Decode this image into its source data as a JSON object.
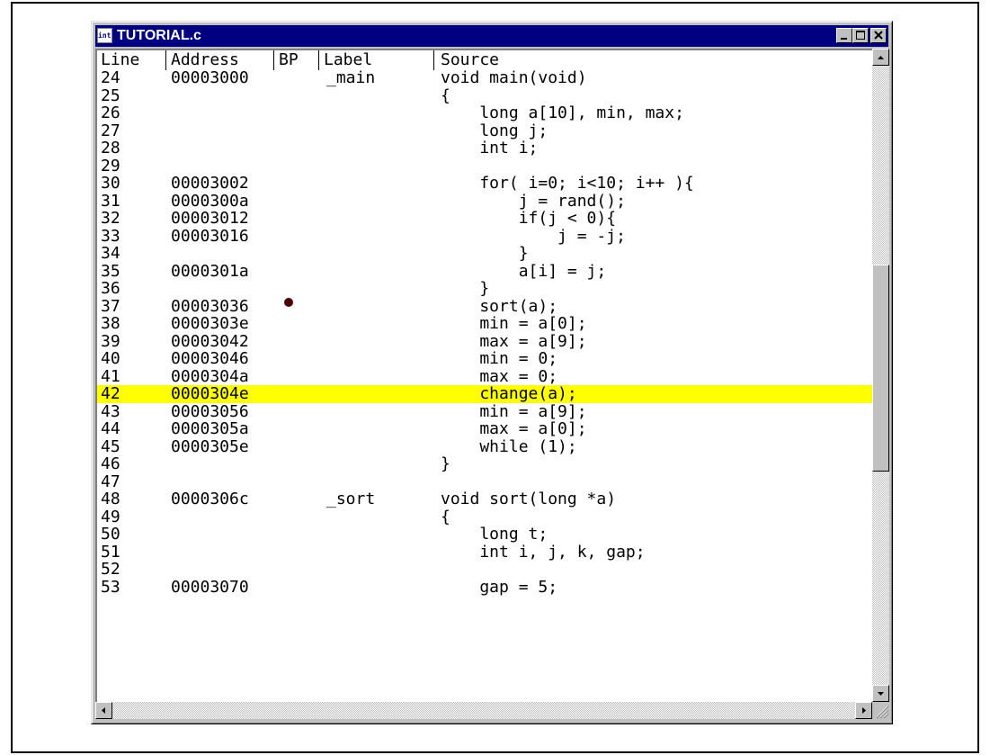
{
  "window": {
    "title": "TUTORIAL.c",
    "icon_text": "intj"
  },
  "columns": [
    "Line",
    "Address",
    "BP",
    "Label",
    "Source"
  ],
  "rows": [
    {
      "line": "24",
      "address": "00003000",
      "bp": false,
      "label": "_main",
      "source": "void main(void)"
    },
    {
      "line": "25",
      "address": "",
      "bp": false,
      "label": "",
      "source": "{"
    },
    {
      "line": "26",
      "address": "",
      "bp": false,
      "label": "",
      "source": "    long a[10], min, max;"
    },
    {
      "line": "27",
      "address": "",
      "bp": false,
      "label": "",
      "source": "    long j;"
    },
    {
      "line": "28",
      "address": "",
      "bp": false,
      "label": "",
      "source": "    int i;"
    },
    {
      "line": "29",
      "address": "",
      "bp": false,
      "label": "",
      "source": ""
    },
    {
      "line": "30",
      "address": "00003002",
      "bp": false,
      "label": "",
      "source": "    for( i=0; i<10; i++ ){"
    },
    {
      "line": "31",
      "address": "0000300a",
      "bp": false,
      "label": "",
      "source": "        j = rand();"
    },
    {
      "line": "32",
      "address": "00003012",
      "bp": false,
      "label": "",
      "source": "        if(j < 0){"
    },
    {
      "line": "33",
      "address": "00003016",
      "bp": false,
      "label": "",
      "source": "            j = -j;"
    },
    {
      "line": "34",
      "address": "",
      "bp": false,
      "label": "",
      "source": "        }"
    },
    {
      "line": "35",
      "address": "0000301a",
      "bp": false,
      "label": "",
      "source": "        a[i] = j;"
    },
    {
      "line": "36",
      "address": "",
      "bp": false,
      "label": "",
      "source": "    }"
    },
    {
      "line": "37",
      "address": "00003036",
      "bp": true,
      "label": "",
      "source": "    sort(a);"
    },
    {
      "line": "38",
      "address": "0000303e",
      "bp": false,
      "label": "",
      "source": "    min = a[0];"
    },
    {
      "line": "39",
      "address": "00003042",
      "bp": false,
      "label": "",
      "source": "    max = a[9];"
    },
    {
      "line": "40",
      "address": "00003046",
      "bp": false,
      "label": "",
      "source": "    min = 0;"
    },
    {
      "line": "41",
      "address": "0000304a",
      "bp": false,
      "label": "",
      "source": "    max = 0;"
    },
    {
      "line": "42",
      "address": "0000304e",
      "bp": false,
      "label": "",
      "source": "    change(a);",
      "current": true
    },
    {
      "line": "43",
      "address": "00003056",
      "bp": false,
      "label": "",
      "source": "    min = a[9];"
    },
    {
      "line": "44",
      "address": "0000305a",
      "bp": false,
      "label": "",
      "source": "    max = a[0];"
    },
    {
      "line": "45",
      "address": "0000305e",
      "bp": false,
      "label": "",
      "source": "    while (1);"
    },
    {
      "line": "46",
      "address": "",
      "bp": false,
      "label": "",
      "source": "}"
    },
    {
      "line": "47",
      "address": "",
      "bp": false,
      "label": "",
      "source": ""
    },
    {
      "line": "48",
      "address": "0000306c",
      "bp": false,
      "label": "_sort",
      "source": "void sort(long *a)"
    },
    {
      "line": "49",
      "address": "",
      "bp": false,
      "label": "",
      "source": "{"
    },
    {
      "line": "50",
      "address": "",
      "bp": false,
      "label": "",
      "source": "    long t;"
    },
    {
      "line": "51",
      "address": "",
      "bp": false,
      "label": "",
      "source": "    int i, j, k, gap;"
    },
    {
      "line": "52",
      "address": "",
      "bp": false,
      "label": "",
      "source": ""
    },
    {
      "line": "53",
      "address": "00003070",
      "bp": false,
      "label": "",
      "source": "    gap = 5;"
    }
  ],
  "colors": {
    "titlebar": "#000080",
    "current_line_highlight": "#ffff00",
    "breakpoint_marker": "#4a0000"
  }
}
